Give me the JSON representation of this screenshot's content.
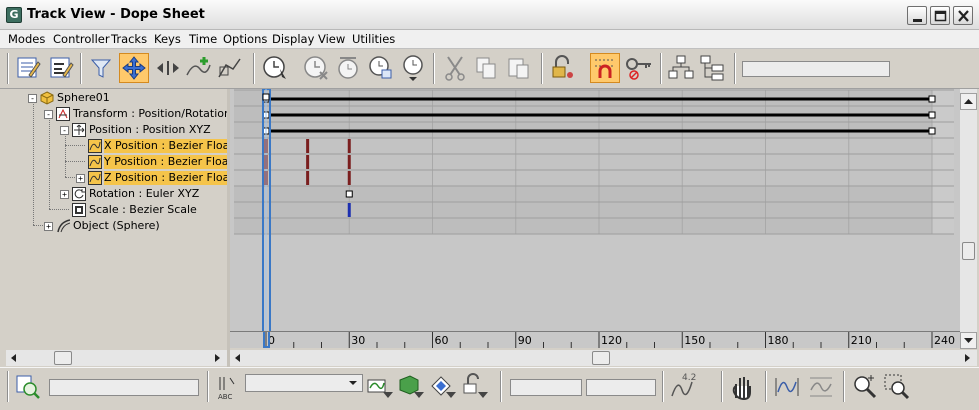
{
  "window": {
    "title": "Track View - Dope Sheet",
    "app_icon_glyph": "G",
    "controls": [
      "minimize-icon",
      "maximize-icon",
      "close-icon"
    ]
  },
  "menu": {
    "items": [
      "Modes",
      "Controller",
      "Tracks",
      "Keys",
      "Time",
      "Options",
      "Display",
      "View",
      "Utilities"
    ]
  },
  "toolbar": {
    "buttons": [
      "edit-keys-icon",
      "edit-ranges-icon",
      "filters-icon",
      "move-keys-icon",
      "slide-keys-icon",
      "add-keys-icon",
      "scale-keys-icon",
      "select-time-icon",
      "delete-time-icon",
      "scale-time-icon",
      "insert-time-icon",
      "reverse-time-icon",
      "cut-icon",
      "copy-icon",
      "paste-icon",
      "lock-selection-icon",
      "snap-frames-icon",
      "show-keyable-icon",
      "modify-subtree-icon",
      "modify-child-keys-icon"
    ],
    "active_button": "snap-frames-icon",
    "field_value": ""
  },
  "tree": {
    "rows": [
      {
        "label": "Sphere01",
        "icon": "sphere-object-icon",
        "toggle": "-",
        "highlight": false
      },
      {
        "label": "Transform : Position/Rotation/S",
        "icon": "transform-controller-icon",
        "toggle": "-",
        "highlight": false
      },
      {
        "label": "Position : Position XYZ",
        "icon": "position-xyz-icon",
        "toggle": "-",
        "highlight": false
      },
      {
        "label": "X Position : Bezier Float",
        "icon": "bezier-float-icon",
        "toggle": "",
        "highlight": true
      },
      {
        "label": "Y Position : Bezier Float",
        "icon": "bezier-float-icon",
        "toggle": "",
        "highlight": true
      },
      {
        "label": "Z Position : Bezier Float",
        "icon": "bezier-float-icon",
        "toggle": "+",
        "highlight": true
      },
      {
        "label": "Rotation : Euler XYZ",
        "icon": "euler-rotation-icon",
        "toggle": "+",
        "highlight": false
      },
      {
        "label": "Scale : Bezier Scale",
        "icon": "bezier-scale-icon",
        "toggle": "",
        "highlight": false
      },
      {
        "label": "Object (Sphere)",
        "icon": "object-sphere-icon",
        "toggle": "+",
        "highlight": false
      }
    ]
  },
  "dope_sheet": {
    "frame_range": [
      0,
      240
    ],
    "current_frame": 0,
    "range_bar_end_frame": 240,
    "keys": [
      {
        "row": 3,
        "frames": [
          0,
          15,
          30
        ],
        "color": "#7a1e1e"
      },
      {
        "row": 4,
        "frames": [
          0,
          15,
          30
        ],
        "color": "#7a1e1e"
      },
      {
        "row": 5,
        "frames": [
          0,
          15,
          30
        ],
        "color": "#7a1e1e"
      },
      {
        "row": 7,
        "frames": [
          30
        ],
        "color": "#1c2fb0"
      }
    ],
    "range_bars_rows": [
      0,
      1,
      2
    ],
    "scale_range_key_frame": 30
  },
  "ruler": {
    "labels": [
      "0",
      "30",
      "60",
      "90",
      "120",
      "150",
      "180",
      "210",
      "240"
    ],
    "label_frames": [
      0,
      30,
      60,
      90,
      120,
      150,
      180,
      210,
      240
    ]
  },
  "bottom_bar": {
    "track_name_field": "",
    "selection_field": "",
    "frame_field": "",
    "value_field": "",
    "zoom_value_label": "4.2",
    "buttons": [
      "zoom-selected-object-icon",
      "rename-track-icon",
      "filter-selected-tracks-icon",
      "filter-selected-objects-icon",
      "filter-animated-icon",
      "filter-unlocked-icon",
      "pan-icon",
      "zoom-horizontal-extents-icon",
      "zoom-value-extents-icon",
      "zoom-icon",
      "zoom-region-icon"
    ]
  },
  "colors": {
    "highlight": "#f5c44a",
    "active_button": "#ffc96b",
    "key_red": "#7a1e1e",
    "key_blue": "#1c2fb0",
    "time_slider": "#3a78c6"
  }
}
